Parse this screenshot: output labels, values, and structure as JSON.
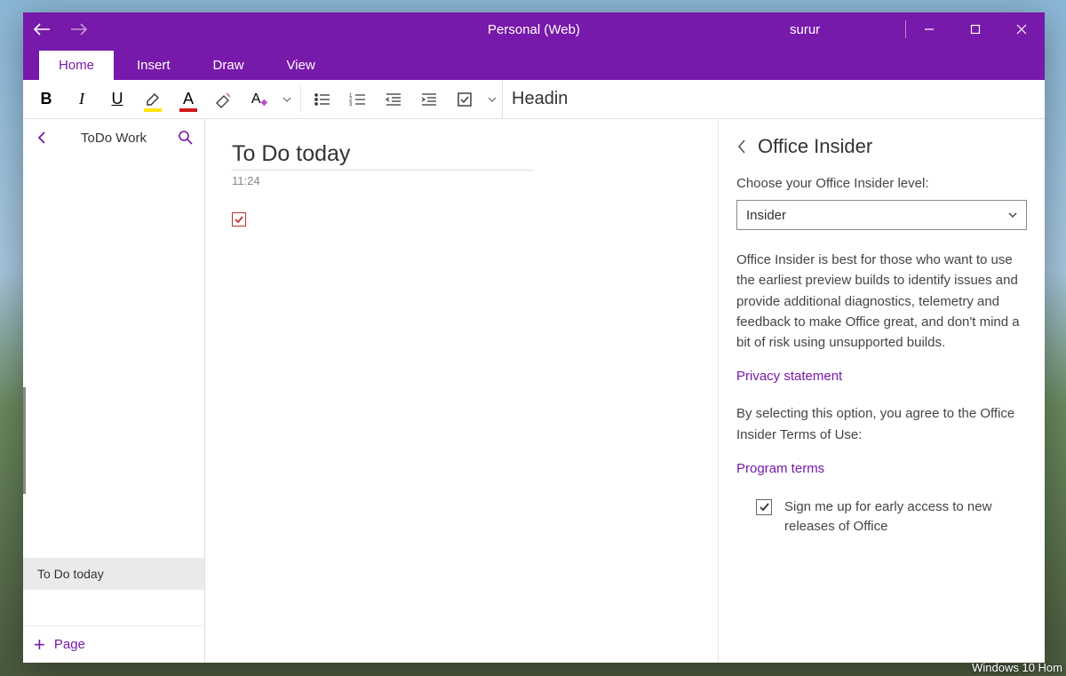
{
  "titlebar": {
    "title": "Personal (Web)",
    "user": "surur"
  },
  "tabs": {
    "items": [
      "Home",
      "Insert",
      "Draw",
      "View"
    ],
    "active_index": 0
  },
  "ribbon": {
    "style_label": "Headin"
  },
  "sidebar": {
    "section_title": "ToDo Work",
    "pages": [
      "To Do today"
    ],
    "active_page_index": 0,
    "add_label": "Page"
  },
  "note": {
    "title": "To Do today",
    "time": "11:24",
    "checkbox_checked": true
  },
  "panel": {
    "title": "Office Insider",
    "choose_label": "Choose your Office Insider level:",
    "select_value": "Insider",
    "description": "Office Insider is best for those who want to use the earliest preview builds to identify issues and provide additional diagnostics, telemetry and feedback to make Office great, and don't mind a bit of risk using unsupported builds.",
    "privacy_link": "Privacy statement",
    "agree_text": "By selecting this option, you agree to the Office Insider Terms of Use:",
    "terms_link": "Program terms",
    "signup_checked": true,
    "signup_label": "Sign me up for early access to new releases of Office"
  },
  "watermark": "Windows 10 Hom"
}
